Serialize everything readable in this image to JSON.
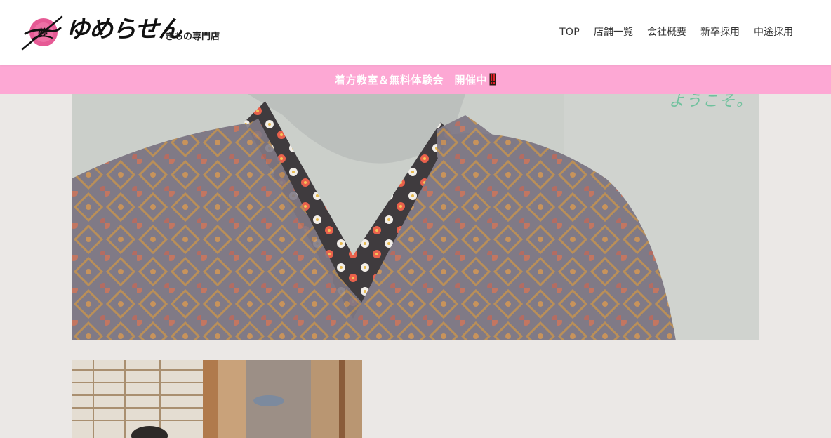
{
  "header": {
    "logo": {
      "wordmark": "ゆめらせん",
      "subtitle": "きもの専門店",
      "emblem_text": "夢",
      "accent_color": "#e23d83"
    },
    "nav": [
      {
        "label": "TOP"
      },
      {
        "label": "店舗一覧"
      },
      {
        "label": "会社概要"
      },
      {
        "label": "新卒採用"
      },
      {
        "label": "中途採用"
      }
    ]
  },
  "announcement": {
    "text": "着方教室＆無料体験会　開催中",
    "icon": "double-exclamation-icon",
    "background": "#fda8d4",
    "text_color": "#ffffff"
  },
  "hero": {
    "image": "kimono-collar-photo",
    "caption_fragment": "ようこそ。"
  },
  "secondary": {
    "image": "shop-interior-photo"
  },
  "colors": {
    "page_background": "#ebe8e6",
    "header_background": "#ffffff"
  }
}
